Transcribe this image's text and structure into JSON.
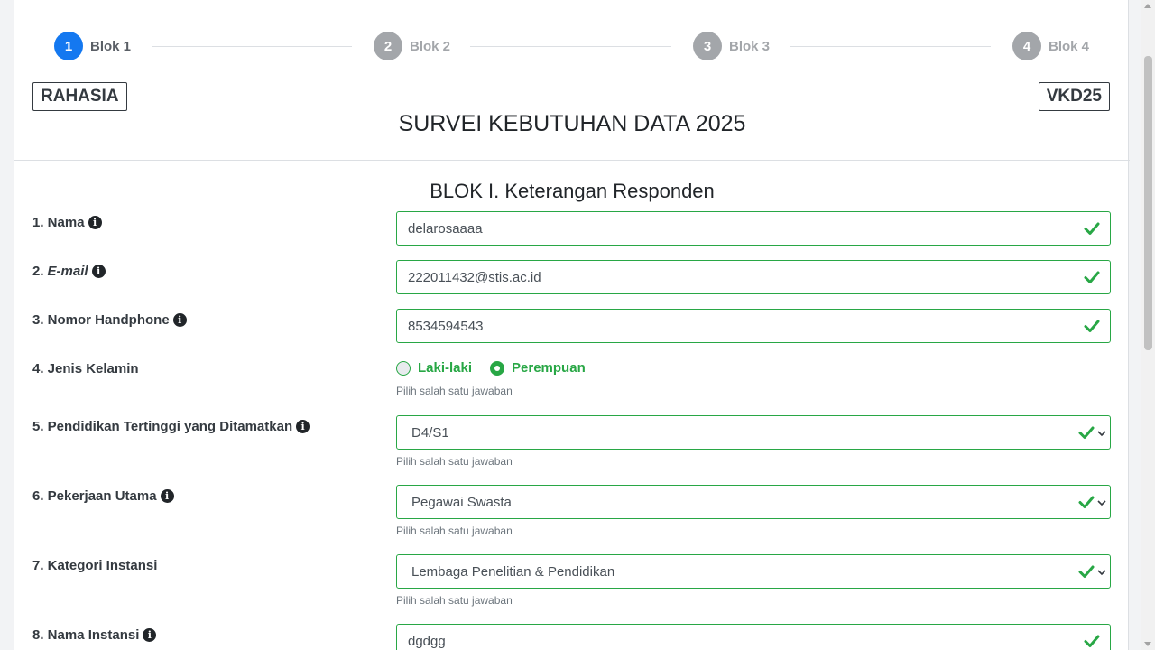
{
  "stepper": {
    "steps": [
      {
        "num": "1",
        "label": "Blok 1"
      },
      {
        "num": "2",
        "label": "Blok 2"
      },
      {
        "num": "3",
        "label": "Blok 3"
      },
      {
        "num": "4",
        "label": "Blok 4"
      }
    ],
    "active_index": 0
  },
  "header": {
    "left_tag": "RAHASIA",
    "right_tag": "VKD25",
    "title": "SURVEI KEBUTUHAN DATA 2025"
  },
  "block": {
    "title": "BLOK I. Keterangan Responden",
    "questions": {
      "q1": {
        "label": "1. Nama",
        "value": "delarosaaaa"
      },
      "q2": {
        "prefix": "2.",
        "label": "E-mail",
        "value": "222011432@stis.ac.id"
      },
      "q3": {
        "label": "3. Nomor Handphone",
        "value": "8534594543"
      },
      "q4": {
        "label": "4. Jenis Kelamin",
        "options": [
          "Laki-laki",
          "Perempuan"
        ],
        "selected": "Perempuan",
        "hint": "Pilih salah satu jawaban"
      },
      "q5": {
        "label": "5. Pendidikan Tertinggi yang Ditamatkan",
        "value": "D4/S1",
        "hint": "Pilih salah satu jawaban"
      },
      "q6": {
        "label": "6. Pekerjaan Utama",
        "value": "Pegawai Swasta",
        "hint": "Pilih salah satu jawaban"
      },
      "q7": {
        "label": "7. Kategori Instansi",
        "value": "Lembaga Penelitian & Pendidikan",
        "hint": "Pilih salah satu jawaban"
      },
      "q8": {
        "label": "8. Nama Instansi",
        "value": "dgdgg"
      }
    }
  },
  "colors": {
    "primary": "#1478f0",
    "valid": "#28a745",
    "step_inactive": "#a3a6aa"
  },
  "icons": {
    "info": "info-icon",
    "valid": "check-icon",
    "dropdown": "chevron-down-icon"
  }
}
